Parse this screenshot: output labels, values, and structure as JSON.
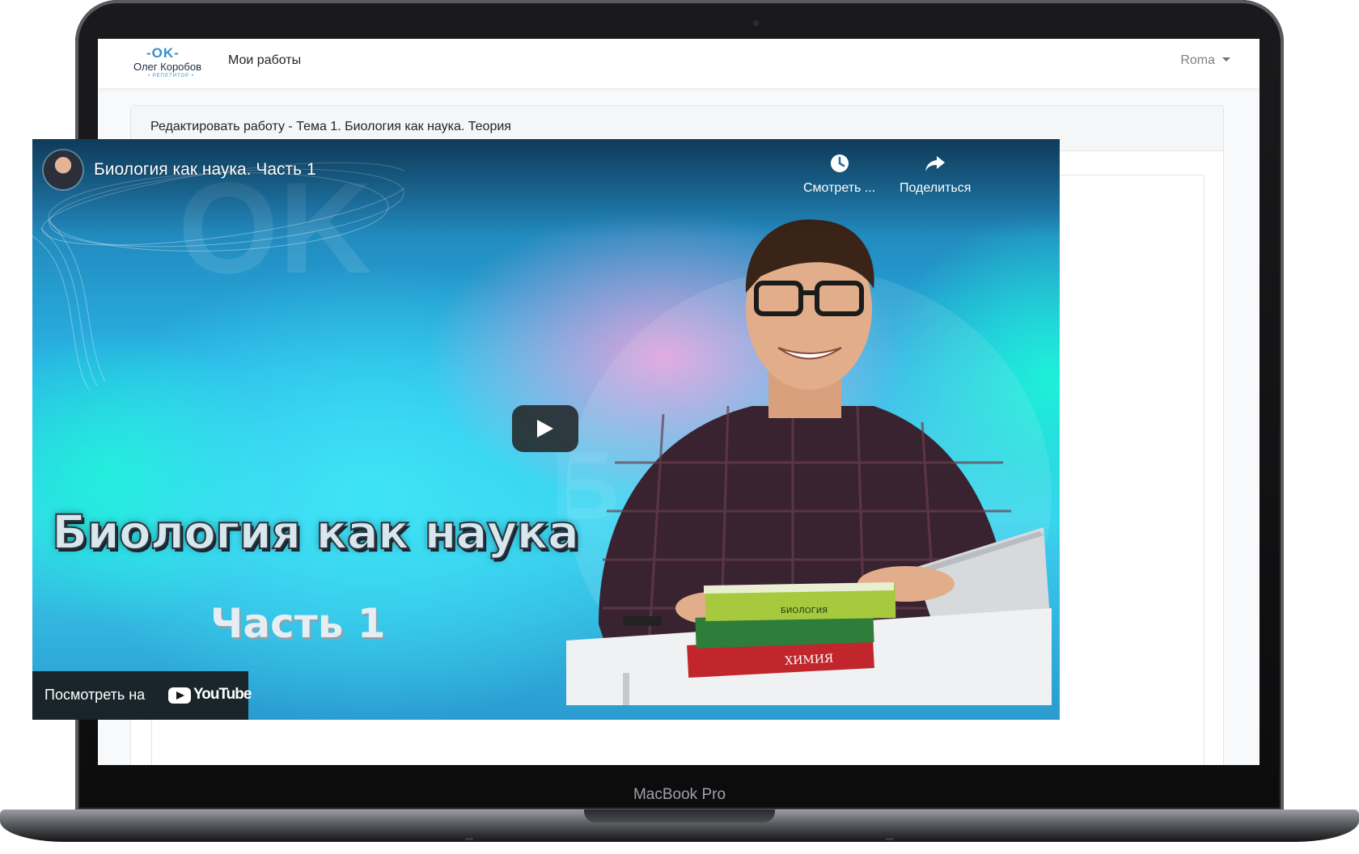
{
  "device": {
    "label": "MacBook Pro"
  },
  "navbar": {
    "logo": {
      "mark": "-OK-",
      "name": "Олег Коробов",
      "subtitle": "• РЕПЕТИТОР •"
    },
    "nav_link": "Мои работы",
    "user": "Roma"
  },
  "card": {
    "header": "Редактировать работу - Тема 1. Биология как наука. Теория"
  },
  "video": {
    "title": "Биология как наука. Часть 1",
    "buttons": [
      {
        "label": "Смотреть ...",
        "icon": "clock-icon"
      },
      {
        "label": "Поделиться",
        "icon": "share-icon"
      }
    ],
    "overlay_title": "Биология как наука",
    "overlay_subtitle": "Часть 1",
    "watch_on": {
      "label": "Посмотреть на",
      "brand": "YouTube"
    }
  },
  "colors": {
    "accent": "#3a8fcf",
    "video_bg": "#2ab6e6",
    "play_button": "#212121"
  }
}
